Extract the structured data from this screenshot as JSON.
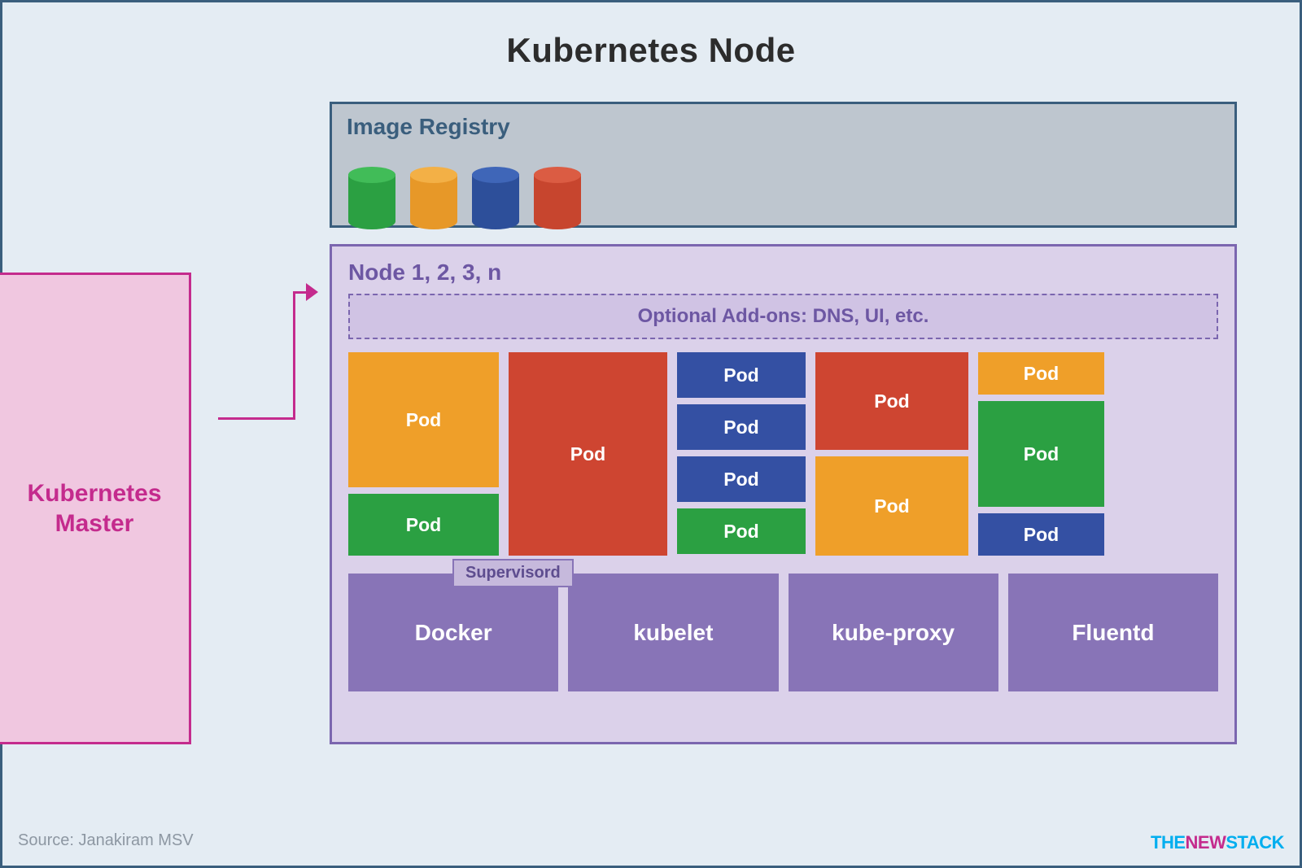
{
  "title": "Kubernetes Node",
  "master": {
    "label": "Kubernetes\nMaster"
  },
  "registry": {
    "title": "Image Registry",
    "images": [
      {
        "color": "green"
      },
      {
        "color": "orange"
      },
      {
        "color": "blue"
      },
      {
        "color": "red"
      }
    ]
  },
  "node": {
    "title": "Node 1, 2, 3, n",
    "addons_label": "Optional Add-ons: DNS, UI, etc.",
    "pod_label": "Pod",
    "supervisord_label": "Supervisord",
    "services": {
      "docker": "Docker",
      "kubelet": "kubelet",
      "kubeproxy": "kube-proxy",
      "fluentd": "Fluentd"
    }
  },
  "source": "Source: Janakiram MSV",
  "logo": {
    "part1": "THE",
    "part2": "NEW",
    "part3": "STACK"
  },
  "colors": {
    "orange": "#ef9f29",
    "green": "#2ba042",
    "red": "#ce4531",
    "blue": "#3450a3",
    "purple": "#8874b7",
    "magenta": "#c42b8d",
    "slate": "#3a5e7d"
  }
}
